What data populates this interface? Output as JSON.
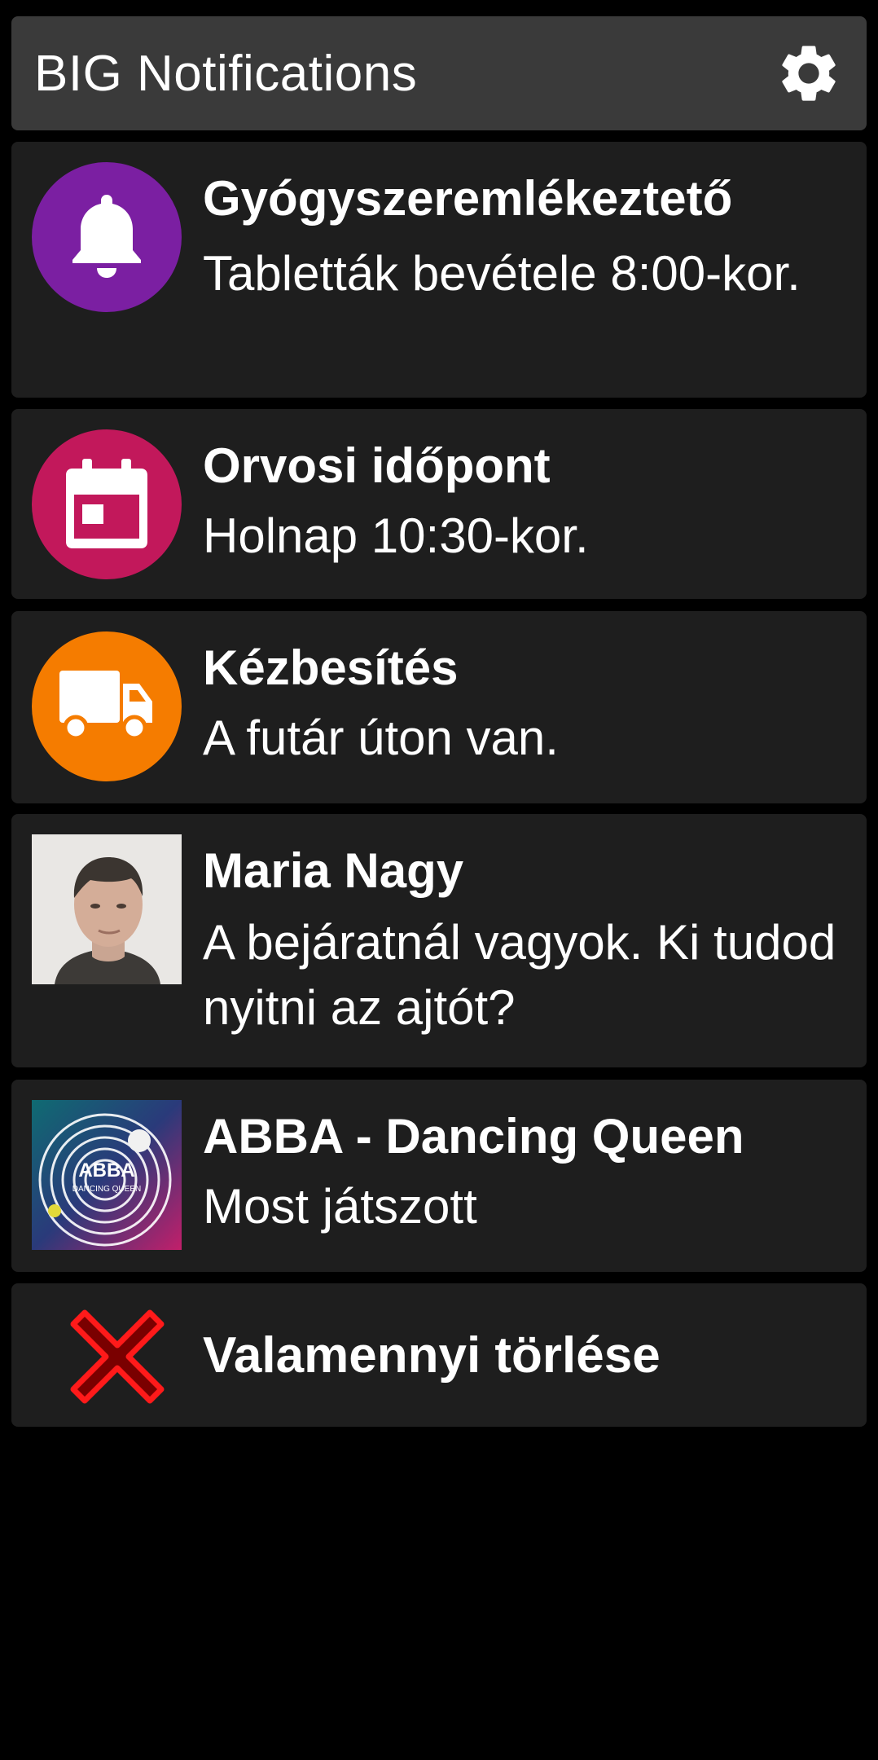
{
  "header": {
    "title": "BIG Notifications",
    "settings_icon": "gear-icon"
  },
  "notifications": [
    {
      "icon": "bell-icon",
      "icon_bg": "#7b1fa2",
      "title": "Gyógyszeremlékeztető",
      "body": "Tabletták bevétele 8:00-kor."
    },
    {
      "icon": "calendar-icon",
      "icon_bg": "#c2185b",
      "title": "Orvosi időpont",
      "body": "Holnap 10:30-kor."
    },
    {
      "icon": "truck-icon",
      "icon_bg": "#f57c00",
      "title": "Kézbesítés",
      "body": "A futár úton van."
    },
    {
      "icon": "avatar-photo",
      "title": "Maria Nagy",
      "body": "A bejáratnál vagyok. Ki tudod nyitni az ajtót?"
    },
    {
      "icon": "album-art",
      "title": "ABBA - Dancing Queen",
      "body": "Most játszott",
      "album_text": [
        "ABBA",
        "DANCING QUEEN"
      ]
    }
  ],
  "clear_all": {
    "label": "Valamennyi törlése",
    "icon": "red-x-icon"
  },
  "colors": {
    "background": "#000000",
    "header": "#3a3a3a",
    "card": "#1e1e1e",
    "text": "#ffffff",
    "clear_icon": "#d50000"
  }
}
